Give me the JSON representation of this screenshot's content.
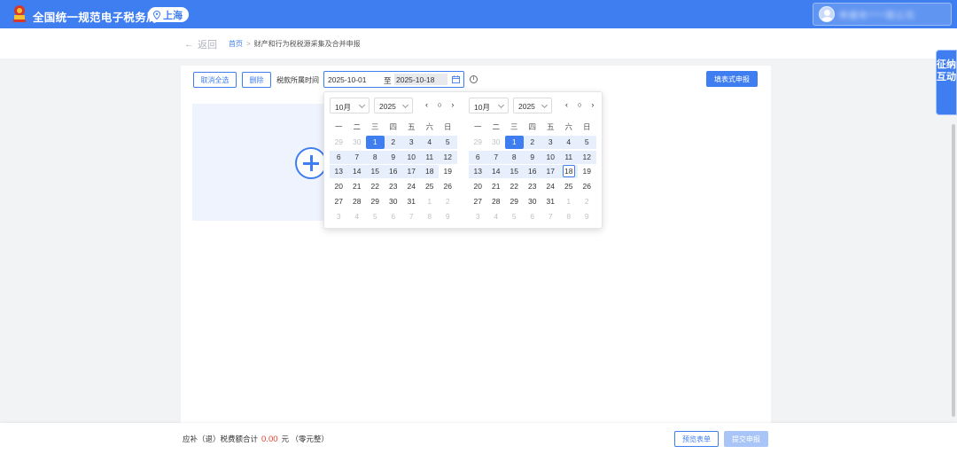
{
  "header": {
    "site_title": "全国统一规范电子税务局",
    "region": "上海",
    "user_name": "申康年****限公司"
  },
  "breadcrumb": {
    "back_label": "返回",
    "home": "首页",
    "separator": ">",
    "current": "财产和行为税税源采集及合并申报"
  },
  "toolbar": {
    "cancel_all_label": "取消全选",
    "delete_label": "删除",
    "period_label": "税款所属时间",
    "date_start": "2025-10-01",
    "date_to": "至",
    "date_end": "2025-10-18",
    "fill_form_label": "填表式申报"
  },
  "calendar": {
    "weekdays": [
      "一",
      "二",
      "三",
      "四",
      "五",
      "六",
      "日"
    ],
    "left": {
      "month": "10月",
      "year": "2025"
    },
    "right": {
      "month": "10月",
      "year": "2025"
    },
    "nav_left": "‹ ○ ›",
    "nav_right": "‹ ○ ›",
    "rows": [
      [
        "29",
        "30",
        "1",
        "2",
        "3",
        "4",
        "5"
      ],
      [
        "6",
        "7",
        "8",
        "9",
        "10",
        "11",
        "12"
      ],
      [
        "13",
        "14",
        "15",
        "16",
        "17",
        "18",
        "19"
      ],
      [
        "20",
        "21",
        "22",
        "23",
        "24",
        "25",
        "26"
      ],
      [
        "27",
        "28",
        "29",
        "30",
        "31",
        "1",
        "2"
      ],
      [
        "3",
        "4",
        "5",
        "6",
        "7",
        "8",
        "9"
      ]
    ]
  },
  "side_tab": "征纳互动",
  "footer": {
    "total_label": "应补（退）税费额合计",
    "amount": "0.00",
    "unit": "元",
    "amount_words": "（零元整）",
    "preview_label": "预览表单",
    "submit_label": "提交申报"
  },
  "colors": {
    "brand_blue": "#3f7ef0",
    "amount_red": "#e8412c"
  }
}
